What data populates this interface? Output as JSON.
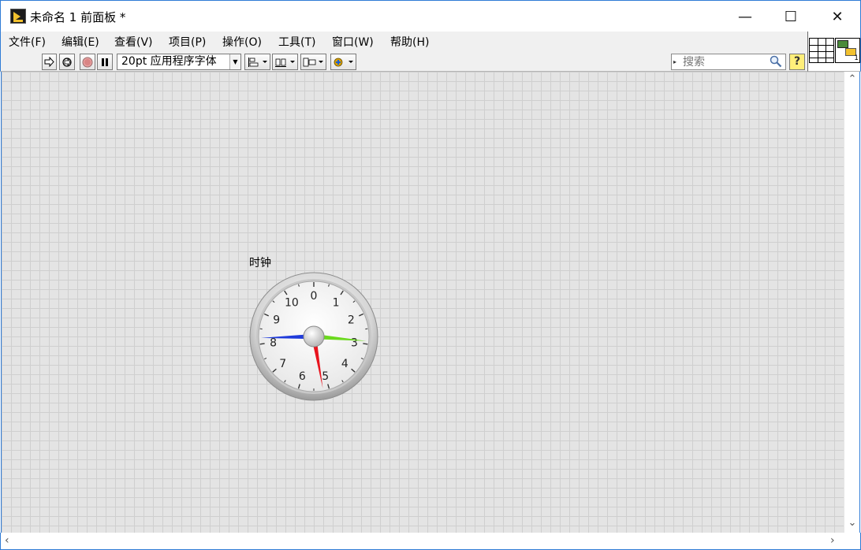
{
  "window": {
    "title": "未命名 1 前面板 *",
    "minimize": "—",
    "maximize": "☐",
    "close": "✕"
  },
  "menu": [
    {
      "label": "文件(F)"
    },
    {
      "label": "编辑(E)"
    },
    {
      "label": "查看(V)"
    },
    {
      "label": "项目(P)"
    },
    {
      "label": "操作(O)"
    },
    {
      "label": "工具(T)"
    },
    {
      "label": "窗口(W)"
    },
    {
      "label": "帮助(H)"
    }
  ],
  "toolbar": {
    "run_icon": "run-arrow-icon",
    "run_continuous_icon": "run-continuously-icon",
    "abort_icon": "abort-icon",
    "pause_icon": "pause-icon",
    "font": "20pt 应用程序字体",
    "align_icon": "align-objects-icon",
    "distribute_icon": "distribute-objects-icon",
    "resize_icon": "resize-objects-icon",
    "reorder_icon": "reorder-icon"
  },
  "search": {
    "placeholder": "搜索",
    "icon": "magnifier-icon"
  },
  "help": {
    "label": "?"
  },
  "clock": {
    "label": "时钟",
    "ticks": [
      "0",
      "1",
      "2",
      "3",
      "4",
      "5",
      "6",
      "7",
      "8",
      "9",
      "10"
    ],
    "scale_min": 0,
    "scale_max": 11,
    "needles": [
      {
        "name": "blue",
        "value": 8.2,
        "color": "#1f3bdb"
      },
      {
        "name": "green",
        "value": 2.9,
        "color": "#6bd91e"
      },
      {
        "name": "red",
        "value": 5.2,
        "color": "#e8141e"
      }
    ]
  }
}
